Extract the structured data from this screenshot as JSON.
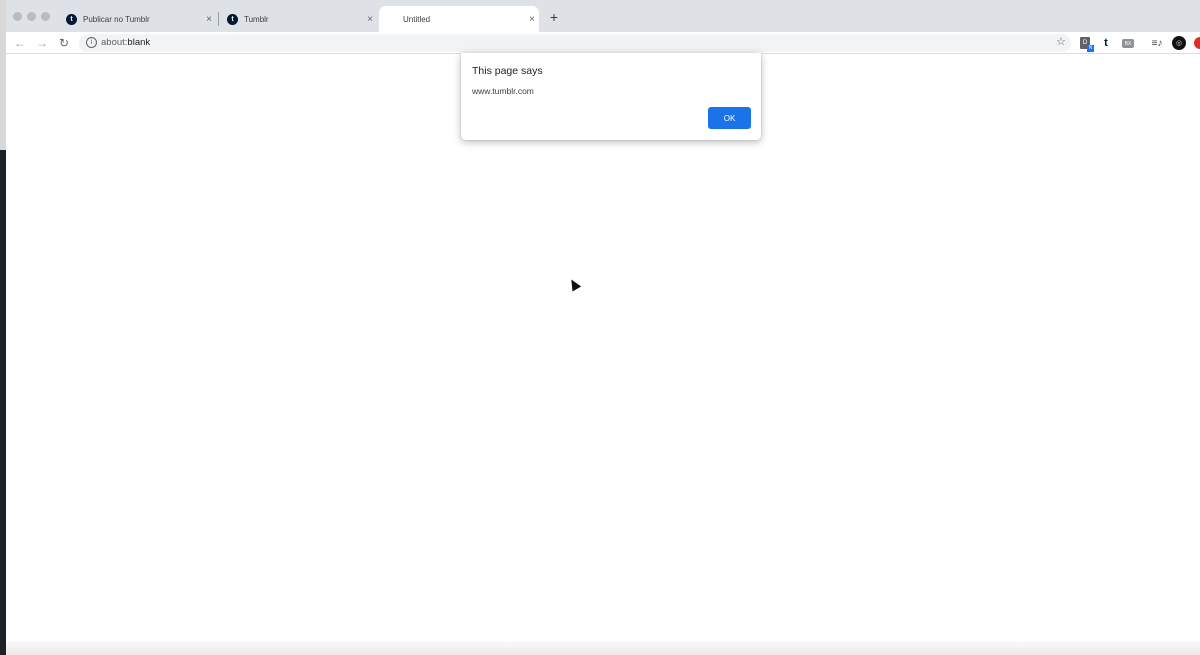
{
  "browser": {
    "tabs": [
      {
        "title": "Publicar no Tumblr",
        "favicon": "tumblr-icon",
        "active": false
      },
      {
        "title": "Tumblr",
        "favicon": "tumblr-icon",
        "active": false
      },
      {
        "title": "Untitled",
        "favicon": "",
        "active": true
      }
    ],
    "new_tab_label": "+",
    "tab_close_label": "×",
    "address": {
      "scheme": "about:",
      "rest": "blank"
    },
    "favicon_letter": "t",
    "extensions": [
      {
        "name": "doc-extension-icon",
        "text": "D",
        "badge": "N"
      },
      {
        "name": "tumblr-extension-icon",
        "text": "t"
      },
      {
        "name": "box-extension-icon",
        "text": "BX"
      },
      {
        "name": "playlist-extension-icon",
        "text": "≡♪"
      },
      {
        "name": "avatar-extension-icon",
        "text": "◎"
      },
      {
        "name": "red-extension-icon",
        "text": ""
      }
    ],
    "accent": "#1a73e8"
  },
  "dialog": {
    "title": "This page says",
    "message": "www.tumblr.com",
    "ok_label": "OK"
  }
}
